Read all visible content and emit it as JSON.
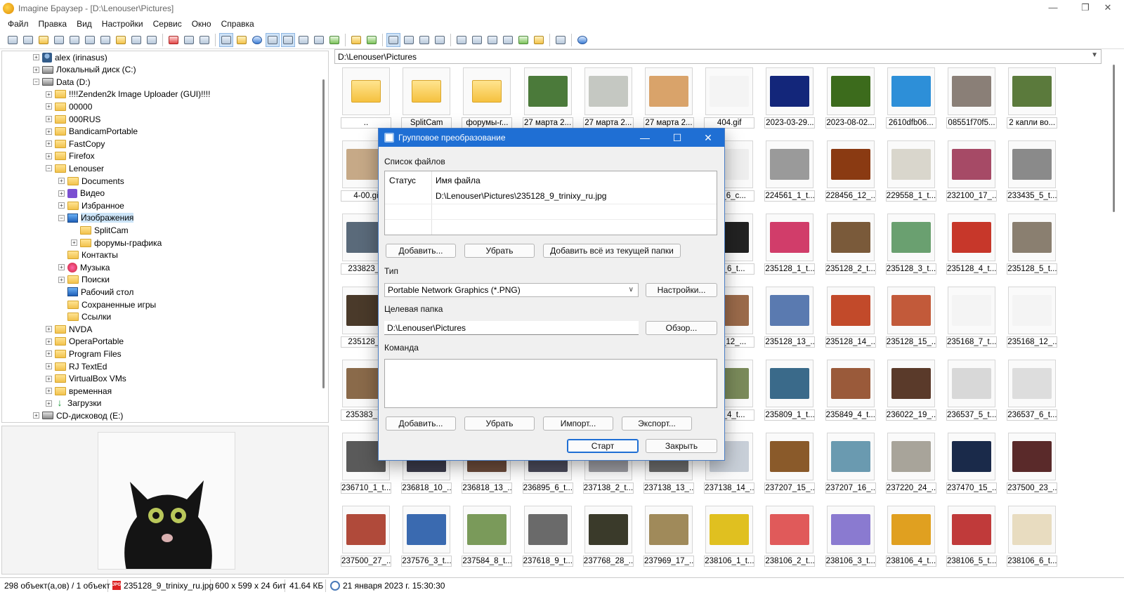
{
  "window": {
    "title": "Imagine Браузер - [D:\\Lenouser\\Pictures]",
    "minimize": "—",
    "maximize": "❐",
    "close": "✕"
  },
  "menu": [
    "Файл",
    "Правка",
    "Вид",
    "Настройки",
    "Сервис",
    "Окно",
    "Справка"
  ],
  "tree": [
    {
      "label": "alex (irinasus)",
      "icon": "user-icon",
      "level": 1,
      "exp": "+"
    },
    {
      "label": "Локальный диск (C:)",
      "icon": "drive-icon",
      "level": 1,
      "exp": "+"
    },
    {
      "label": "Data (D:)",
      "icon": "drive-icon",
      "level": 1,
      "exp": "−"
    },
    {
      "label": "!!!!Zenden2k Image Uploader (GUI)!!!!",
      "icon": "folder-icon",
      "level": 2,
      "exp": "+"
    },
    {
      "label": "00000",
      "icon": "folder-icon",
      "level": 2,
      "exp": "+"
    },
    {
      "label": "000RUS",
      "icon": "folder-icon",
      "level": 2,
      "exp": "+"
    },
    {
      "label": "BandicamPortable",
      "icon": "folder-icon",
      "level": 2,
      "exp": "+"
    },
    {
      "label": "FastCopy",
      "icon": "folder-icon",
      "level": 2,
      "exp": "+"
    },
    {
      "label": "Firefox",
      "icon": "folder-icon",
      "level": 2,
      "exp": "+"
    },
    {
      "label": "Lenouser",
      "icon": "folder-icon",
      "level": 2,
      "exp": "−"
    },
    {
      "label": "Documents",
      "icon": "folder-icon",
      "level": 3,
      "exp": "+"
    },
    {
      "label": "Видео",
      "icon": "video-icon",
      "level": 3,
      "exp": "+"
    },
    {
      "label": "Избранное",
      "icon": "folder-icon",
      "level": 3,
      "exp": "+"
    },
    {
      "label": "Изображения",
      "icon": "pictures-icon",
      "level": 3,
      "exp": "−",
      "selected": true
    },
    {
      "label": "SplitCam",
      "icon": "folder-icon",
      "level": 4,
      "exp": ""
    },
    {
      "label": "форумы-графика",
      "icon": "folder-icon",
      "level": 4,
      "exp": "+"
    },
    {
      "label": "Контакты",
      "icon": "folder-icon",
      "level": 3,
      "exp": ""
    },
    {
      "label": "Музыка",
      "icon": "music-icon",
      "level": 3,
      "exp": "+"
    },
    {
      "label": "Поиски",
      "icon": "folder-icon",
      "level": 3,
      "exp": "+"
    },
    {
      "label": "Рабочий стол",
      "icon": "desktop-icon",
      "level": 3,
      "exp": ""
    },
    {
      "label": "Сохраненные игры",
      "icon": "folder-icon",
      "level": 3,
      "exp": ""
    },
    {
      "label": "Ссылки",
      "icon": "folder-icon",
      "level": 3,
      "exp": ""
    },
    {
      "label": "NVDA",
      "icon": "folder-icon",
      "level": 2,
      "exp": "+"
    },
    {
      "label": "OperaPortable",
      "icon": "folder-icon",
      "level": 2,
      "exp": "+"
    },
    {
      "label": "Program Files",
      "icon": "folder-icon",
      "level": 2,
      "exp": "+"
    },
    {
      "label": "RJ TextEd",
      "icon": "folder-icon",
      "level": 2,
      "exp": "+"
    },
    {
      "label": "VirtualBox VMs",
      "icon": "folder-icon",
      "level": 2,
      "exp": "+"
    },
    {
      "label": "временная",
      "icon": "folder-icon",
      "level": 2,
      "exp": "+"
    },
    {
      "label": "Загрузки",
      "icon": "download-icon",
      "level": 2,
      "exp": "+"
    },
    {
      "label": "CD-дисковод (E:)",
      "icon": "drive-icon",
      "level": 1,
      "exp": "+"
    }
  ],
  "address": "D:\\Lenouser\\Pictures",
  "thumbnails": [
    [
      "..",
      "SplitCam",
      "форумы-г...",
      "27 марта 2...",
      "27 марта 2...",
      "27 марта 2...",
      "404.gif",
      "2023-03-29...",
      "2023-08-02...",
      "2610dfb06...",
      "08551f70f5...",
      "2 капли во..."
    ],
    [
      "4-00.gi",
      "",
      "",
      "",
      "",
      "",
      "30_6_c...",
      "224561_1_t...",
      "228456_12_...",
      "229558_1_t...",
      "232100_17_...",
      "233435_5_t..."
    ],
    [
      "233823_7",
      "",
      "",
      "",
      "",
      "",
      "52_6_t...",
      "235128_1_t...",
      "235128_2_t...",
      "235128_3_t...",
      "235128_4_t...",
      "235128_5_t..."
    ],
    [
      "235128_6",
      "",
      "",
      "",
      "",
      "",
      "28_12_...",
      "235128_13_...",
      "235128_14_...",
      "235128_15_...",
      "235168_7_t...",
      "235168_12_..."
    ],
    [
      "235383_18",
      "",
      "",
      "",
      "",
      "",
      "70_4_t...",
      "235809_1_t...",
      "235849_4_t...",
      "236022_19_...",
      "236537_5_t...",
      "236537_6_t..."
    ],
    [
      "236710_1_t...",
      "236818_10_...",
      "236818_13_...",
      "236895_6_t...",
      "237138_2_t...",
      "237138_13_...",
      "237138_14_...",
      "237207_15_...",
      "237207_16_...",
      "237220_24_...",
      "237470_15_...",
      "237500_23_..."
    ],
    [
      "237500_27_...",
      "237576_3_t...",
      "237584_8_t...",
      "237618_9_t...",
      "237768_28_...",
      "237969_17_...",
      "238106_1_t...",
      "238106_2_t...",
      "238106_3_t...",
      "238106_4_t...",
      "238106_5_t...",
      "238106_6_t..."
    ]
  ],
  "thumb_colors": [
    [
      "#ffffff",
      "#ffffff",
      "#ffffff",
      "#4b7a3a",
      "#c5c8c2",
      "#d9a36a",
      "#f4f4f4",
      "#13267a",
      "#3c6b1c",
      "#2d8fd8",
      "#8a7f77",
      "#5b7a3c"
    ],
    [
      "#c6a987",
      "#ffffff",
      "#ffffff",
      "#ffffff",
      "#ffffff",
      "#ffffff",
      "#eeeeee",
      "#9a9a9a",
      "#8a3a12",
      "#d9d6cc",
      "#a64a66",
      "#8a8a8a"
    ],
    [
      "#5a6a7a",
      "#ffffff",
      "#ffffff",
      "#ffffff",
      "#ffffff",
      "#ffffff",
      "#222222",
      "#d13d6a",
      "#7a5a3a",
      "#6aa070",
      "#c7372a",
      "#8a7f70"
    ],
    [
      "#4a3a2a",
      "#ffffff",
      "#ffffff",
      "#ffffff",
      "#ffffff",
      "#ffffff",
      "#9a6a4a",
      "#5a7ab0",
      "#c24a2a",
      "#c25a3a",
      "#f4f4f4",
      "#f4f4f4"
    ],
    [
      "#8a6a4a",
      "#ffffff",
      "#ffffff",
      "#ffffff",
      "#ffffff",
      "#ffffff",
      "#7a8a5a",
      "#3a6a8a",
      "#9a5a3a",
      "#5a3a2a",
      "#d8d8d8",
      "#dddddd"
    ],
    [
      "#5a5a5a",
      "#3a3a4a",
      "#6a4a3a",
      "#4a4a5a",
      "#9a9aa0",
      "#6a6a6a",
      "#c8cfd8",
      "#8a5a2a",
      "#6a9ab0",
      "#a8a49a",
      "#1a2a4a",
      "#5a2a2a"
    ],
    [
      "#b04a3a",
      "#3a6ab0",
      "#7a9a5a",
      "#6a6a6a",
      "#3a3a2a",
      "#a08a5a",
      "#e0c020",
      "#e05a5a",
      "#8a7ad0",
      "#e0a020",
      "#c03a3a",
      "#e8dcc0"
    ]
  ],
  "status": {
    "count": "298 объект(а,ов) / 1 объект",
    "file": "235128_9_trinixy_ru.jpg",
    "dims": "600 x 599 x 24 бит",
    "size": "41.64 КБ",
    "date": "21 января 2023 г. 15:30:30",
    "file_icon_text": "JPG"
  },
  "dialog": {
    "title": "Групповое преобразование",
    "file_list_label": "Список файлов",
    "col_status": "Статус",
    "col_name": "Имя файла",
    "file_row": "D:\\Lenouser\\Pictures\\235128_9_trinixy_ru.jpg",
    "add": "Добавить...",
    "remove": "Убрать",
    "add_all": "Добавить всё из текущей папки",
    "type_label": "Тип",
    "type_value": "Portable Network Graphics (*.PNG)",
    "settings": "Настройки...",
    "target_label": "Целевая папка",
    "target_value": "D:\\Lenouser\\Pictures",
    "browse": "Обзор...",
    "command_label": "Команда",
    "cmd_add": "Добавить...",
    "cmd_remove": "Убрать",
    "import": "Импорт...",
    "export": "Экспорт...",
    "start": "Старт",
    "close": "Закрыть"
  },
  "accent": "#1f6fd4"
}
